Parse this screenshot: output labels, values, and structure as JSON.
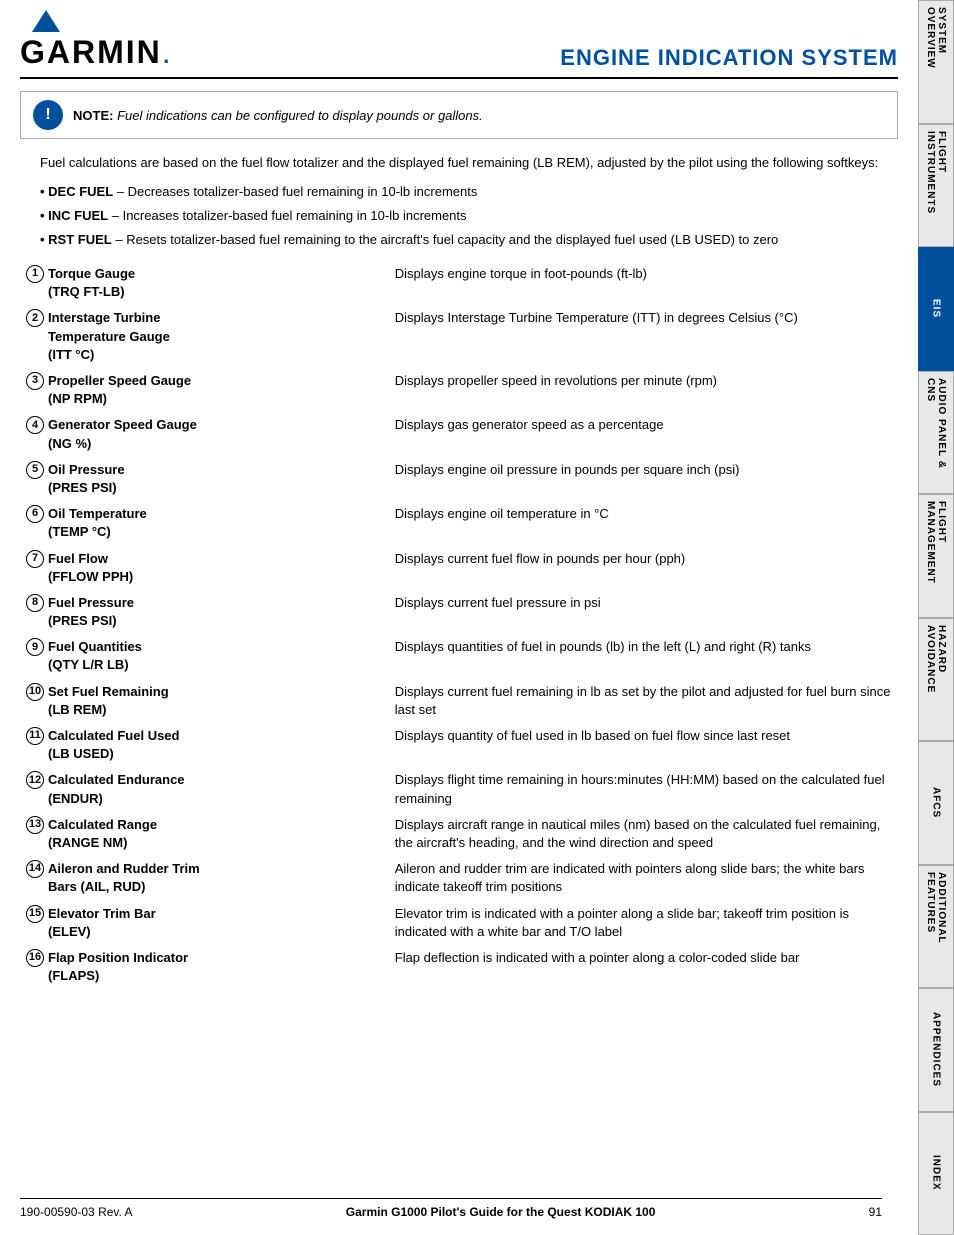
{
  "header": {
    "logo_text": "GARMIN",
    "page_title": "ENGINE INDICATION SYSTEM"
  },
  "note": {
    "label": "NOTE:",
    "text": "Fuel indications can be configured to display pounds or gallons."
  },
  "body_paragraph": "Fuel calculations are based on the fuel flow totalizer and the displayed fuel remaining (LB REM), adjusted by the pilot using the following softkeys:",
  "bullets": [
    {
      "key": "DEC FUEL",
      "desc": "Decreases totalizer-based fuel remaining in 10-lb increments"
    },
    {
      "key": "INC FUEL",
      "desc": "Increases totalizer-based fuel remaining in 10-lb increments"
    },
    {
      "key": "RST FUEL",
      "desc": "Resets totalizer-based fuel remaining to the aircraft's fuel capacity and the displayed fuel used (LB USED) to zero"
    }
  ],
  "items": [
    {
      "num": "1",
      "label": "Torque Gauge\n(TRQ FT-LB)",
      "desc": "Displays engine torque in foot-pounds (ft-lb)"
    },
    {
      "num": "2",
      "label": "Interstage Turbine\nTemperature Gauge\n(ITT °C)",
      "desc": "Displays Interstage Turbine Temperature (ITT) in degrees Celsius (°C)"
    },
    {
      "num": "3",
      "label": "Propeller Speed Gauge\n(NP RPM)",
      "desc": "Displays propeller speed in revolutions per minute (rpm)"
    },
    {
      "num": "4",
      "label": "Generator Speed Gauge\n(NG %)",
      "desc": "Displays gas generator speed as a percentage"
    },
    {
      "num": "5",
      "label": "Oil Pressure\n(PRES PSI)",
      "desc": "Displays engine oil pressure in pounds per square inch (psi)"
    },
    {
      "num": "6",
      "label": "Oil Temperature\n(TEMP °C)",
      "desc": "Displays engine oil temperature in °C"
    },
    {
      "num": "7",
      "label": "Fuel Flow\n(FFLOW PPH)",
      "desc": "Displays current fuel flow in pounds per hour (pph)"
    },
    {
      "num": "8",
      "label": "Fuel Pressure\n(PRES PSI)",
      "desc": "Displays current fuel pressure in psi"
    },
    {
      "num": "9",
      "label": "Fuel Quantities\n(QTY L/R LB)",
      "desc": "Displays quantities of fuel in pounds (lb) in the left (L) and right (R) tanks"
    },
    {
      "num": "10",
      "label": "Set Fuel Remaining\n(LB REM)",
      "desc": "Displays current fuel remaining in lb as set by the pilot and adjusted for fuel burn since last set"
    },
    {
      "num": "11",
      "label": "Calculated Fuel Used\n(LB USED)",
      "desc": "Displays quantity of fuel used in lb based on fuel flow since last reset"
    },
    {
      "num": "12",
      "label": "Calculated Endurance\n(ENDUR)",
      "desc": "Displays flight time remaining in hours:minutes (HH:MM) based on the calculated fuel remaining"
    },
    {
      "num": "13",
      "label": "Calculated Range\n(RANGE NM)",
      "desc": "Displays aircraft range in nautical miles (nm) based on the calculated fuel remaining, the aircraft's heading, and the wind direction and speed"
    },
    {
      "num": "14",
      "label": "Aileron and Rudder Trim\nBars (AIL, RUD)",
      "desc": "Aileron and rudder trim are indicated with pointers along slide bars; the white bars indicate takeoff trim positions"
    },
    {
      "num": "15",
      "label": "Elevator Trim Bar\n(ELEV)",
      "desc": "Elevator trim is indicated with a pointer along a slide bar; takeoff trim position is indicated with a white bar and T/O label"
    },
    {
      "num": "16",
      "label": "Flap Position Indicator\n(FLAPS)",
      "desc": "Flap deflection is indicated with a pointer along a color-coded slide bar"
    }
  ],
  "footer": {
    "left": "190-00590-03  Rev. A",
    "center": "Garmin G1000 Pilot's Guide for the Quest KODIAK 100",
    "right": "91"
  },
  "sidebar_tabs": [
    {
      "label": "SYSTEM\nOVERVIEW",
      "active": false
    },
    {
      "label": "FLIGHT\nINSTRUMENTS",
      "active": false
    },
    {
      "label": "EIS",
      "active": true
    },
    {
      "label": "AUDIO PANEL\n& CNS",
      "active": false
    },
    {
      "label": "FLIGHT\nMANAGEMENT",
      "active": false
    },
    {
      "label": "HAZARD\nAVOIDANCE",
      "active": false
    },
    {
      "label": "AFCS",
      "active": false
    },
    {
      "label": "ADDITIONAL\nFEATURES",
      "active": false
    },
    {
      "label": "APPENDICES",
      "active": false
    },
    {
      "label": "INDEX",
      "active": false
    }
  ]
}
